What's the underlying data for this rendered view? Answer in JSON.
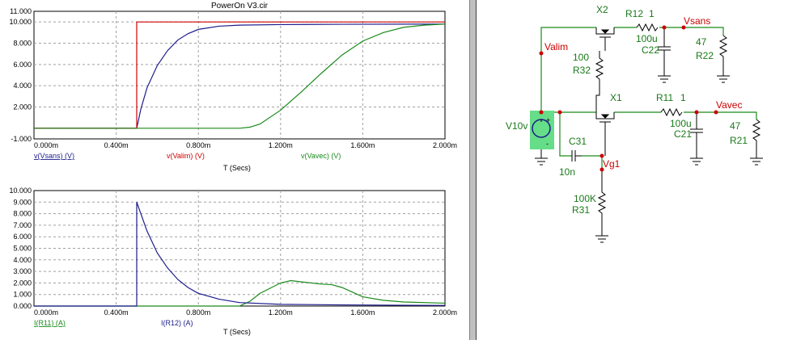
{
  "window": {
    "title": "PowerOn V3.cir"
  },
  "colors": {
    "series_blue": "#1c1c8c",
    "series_red": "#d00000",
    "series_green": "#1a8a1a",
    "grid": "#a0a0a0",
    "schematic_wire": "#1a8a1a",
    "schematic_comp": "#000000",
    "label_green": "#1a7a1a",
    "net_red": "#cc0000",
    "source_fill": "#66dd88"
  },
  "chart_data": [
    {
      "type": "line",
      "title": "PowerOn V3.cir",
      "xlabel": "T (Secs)",
      "ylabel": "",
      "xlim": [
        0,
        2.0
      ],
      "ylim": [
        -1.0,
        10.0
      ],
      "x_tick_values": [
        0,
        0.4,
        0.8,
        1.2,
        1.6,
        2.0
      ],
      "x_tick_labels": [
        "0.000m",
        "0.400m",
        "0.800m",
        "1.200m",
        "1.600m",
        "2.000m"
      ],
      "y_tick_values": [
        -1,
        2,
        4,
        6,
        8,
        10,
        11
      ],
      "y_tick_labels": [
        "-1.000",
        "2.000",
        "4.000",
        "6.000",
        "8.000",
        "10.000",
        "11.000"
      ],
      "grid": true,
      "series": [
        {
          "name": "v(Vsans) (V)",
          "color": "#1c1c8c",
          "x": [
            0,
            0.5,
            0.52,
            0.55,
            0.6,
            0.65,
            0.7,
            0.75,
            0.8,
            0.9,
            1.0,
            1.2,
            1.5,
            2.0
          ],
          "y": [
            0,
            0,
            1.8,
            3.8,
            5.9,
            7.3,
            8.3,
            8.9,
            9.3,
            9.6,
            9.7,
            9.75,
            9.78,
            9.8
          ]
        },
        {
          "name": "v(Valim) (V)",
          "color": "#d00000",
          "x": [
            0,
            0.5,
            0.5,
            2.0
          ],
          "y": [
            0,
            0,
            10,
            10
          ]
        },
        {
          "name": "v(Vavec) (V)",
          "color": "#1a8a1a",
          "x": [
            0,
            1.0,
            1.05,
            1.1,
            1.2,
            1.3,
            1.4,
            1.5,
            1.6,
            1.7,
            1.8,
            1.9,
            2.0
          ],
          "y": [
            0,
            0,
            0.1,
            0.4,
            1.7,
            3.4,
            5.2,
            6.9,
            8.2,
            9.0,
            9.5,
            9.7,
            9.8
          ]
        }
      ]
    },
    {
      "type": "line",
      "title": "",
      "xlabel": "T (Secs)",
      "ylabel": "",
      "xlim": [
        0,
        2.0
      ],
      "ylim": [
        0,
        10.0
      ],
      "x_tick_values": [
        0,
        0.4,
        0.8,
        1.2,
        1.6,
        2.0
      ],
      "x_tick_labels": [
        "0.000m",
        "0.400m",
        "0.800m",
        "1.200m",
        "1.600m",
        "2.000m"
      ],
      "y_tick_values": [
        0,
        1,
        2,
        3,
        4,
        5,
        6,
        7,
        8,
        9,
        10
      ],
      "y_tick_labels": [
        "0.000",
        "1.000",
        "2.000",
        "3.000",
        "4.000",
        "5.000",
        "6.000",
        "7.000",
        "8.000",
        "9.000",
        "10.000"
      ],
      "grid": true,
      "series": [
        {
          "name": "I(R11) (A)",
          "color": "#1a8a1a",
          "x": [
            0,
            1.0,
            1.05,
            1.1,
            1.2,
            1.25,
            1.3,
            1.4,
            1.45,
            1.5,
            1.55,
            1.6,
            1.7,
            1.8,
            2.0
          ],
          "y": [
            0,
            0,
            0.4,
            1.1,
            2.0,
            2.2,
            2.1,
            1.9,
            1.85,
            1.6,
            1.2,
            0.8,
            0.5,
            0.35,
            0.25
          ]
        },
        {
          "name": "I(R12) (A)",
          "color": "#1c1c8c",
          "x": [
            0,
            0.5,
            0.5,
            0.55,
            0.6,
            0.65,
            0.7,
            0.75,
            0.8,
            0.9,
            1.0,
            1.2,
            1.5,
            2.0
          ],
          "y": [
            0,
            0,
            9.0,
            6.5,
            4.6,
            3.3,
            2.3,
            1.6,
            1.1,
            0.6,
            0.3,
            0.15,
            0.1,
            0.05
          ]
        }
      ]
    }
  ],
  "schematic": {
    "labels": {
      "x2": "X2",
      "x1": "X1",
      "r12": "R12",
      "r12_val": "1",
      "r11": "R11",
      "r11_val": "1",
      "vsans": "Vsans",
      "vavec": "Vavec",
      "valim": "Valim",
      "vg1": "Vg1",
      "c22_val": "100u",
      "c22": "C22",
      "c21_val": "100u",
      "c21": "C21",
      "r22_val": "47",
      "r22": "R22",
      "r21_val": "47",
      "r21": "R21",
      "r32_val": "100",
      "r32": "R32",
      "r31_val": "100K",
      "r31": "R31",
      "c31": "C31",
      "c31_val": "10n",
      "v10": "V10v",
      "plus": "+",
      "minus": "-"
    }
  }
}
